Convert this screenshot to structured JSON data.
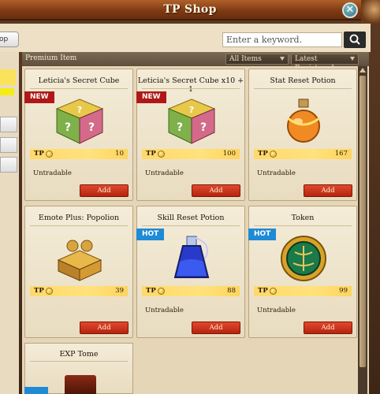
{
  "window": {
    "title": "TP Shop",
    "close_glyph": "✕"
  },
  "toolbar": {
    "shop_tab_label": "op",
    "search_placeholder": "Enter a keyword."
  },
  "panel": {
    "category_label": "Premium Item",
    "filter_label": "All Items",
    "sort_label": "Latest Registered"
  },
  "common": {
    "currency": "TP",
    "add_label": "Add",
    "untradable": "Untradable"
  },
  "items": [
    {
      "name": "Leticia's Secret Cube",
      "badge": "NEW",
      "price": "10",
      "untradable": true,
      "icon": "mystery-cube-icon"
    },
    {
      "name": "Leticia's Secret Cube x10 + 1",
      "badge": "NEW",
      "price": "100",
      "untradable": true,
      "icon": "mystery-cube-icon"
    },
    {
      "name": "Stat Reset Potion",
      "badge": "",
      "price": "167",
      "untradable": true,
      "icon": "orange-potion-icon"
    },
    {
      "name": "Emote Plus: Popolion",
      "badge": "",
      "price": "39",
      "untradable": false,
      "icon": "gold-chest-icon"
    },
    {
      "name": "Skill Reset Potion",
      "badge": "HOT",
      "price": "88",
      "untradable": true,
      "icon": "blue-potion-icon"
    },
    {
      "name": "Token",
      "badge": "HOT",
      "price": "99",
      "untradable": true,
      "icon": "green-token-icon"
    },
    {
      "name": "EXP Tome",
      "badge": "",
      "price": "",
      "untradable": false,
      "icon": "tome-icon"
    }
  ],
  "colors": {
    "new_badge": "#b01818",
    "hot_badge": "#1f8ad6",
    "add_button": "#c8321a",
    "price_bar": "#ffdc6e"
  }
}
